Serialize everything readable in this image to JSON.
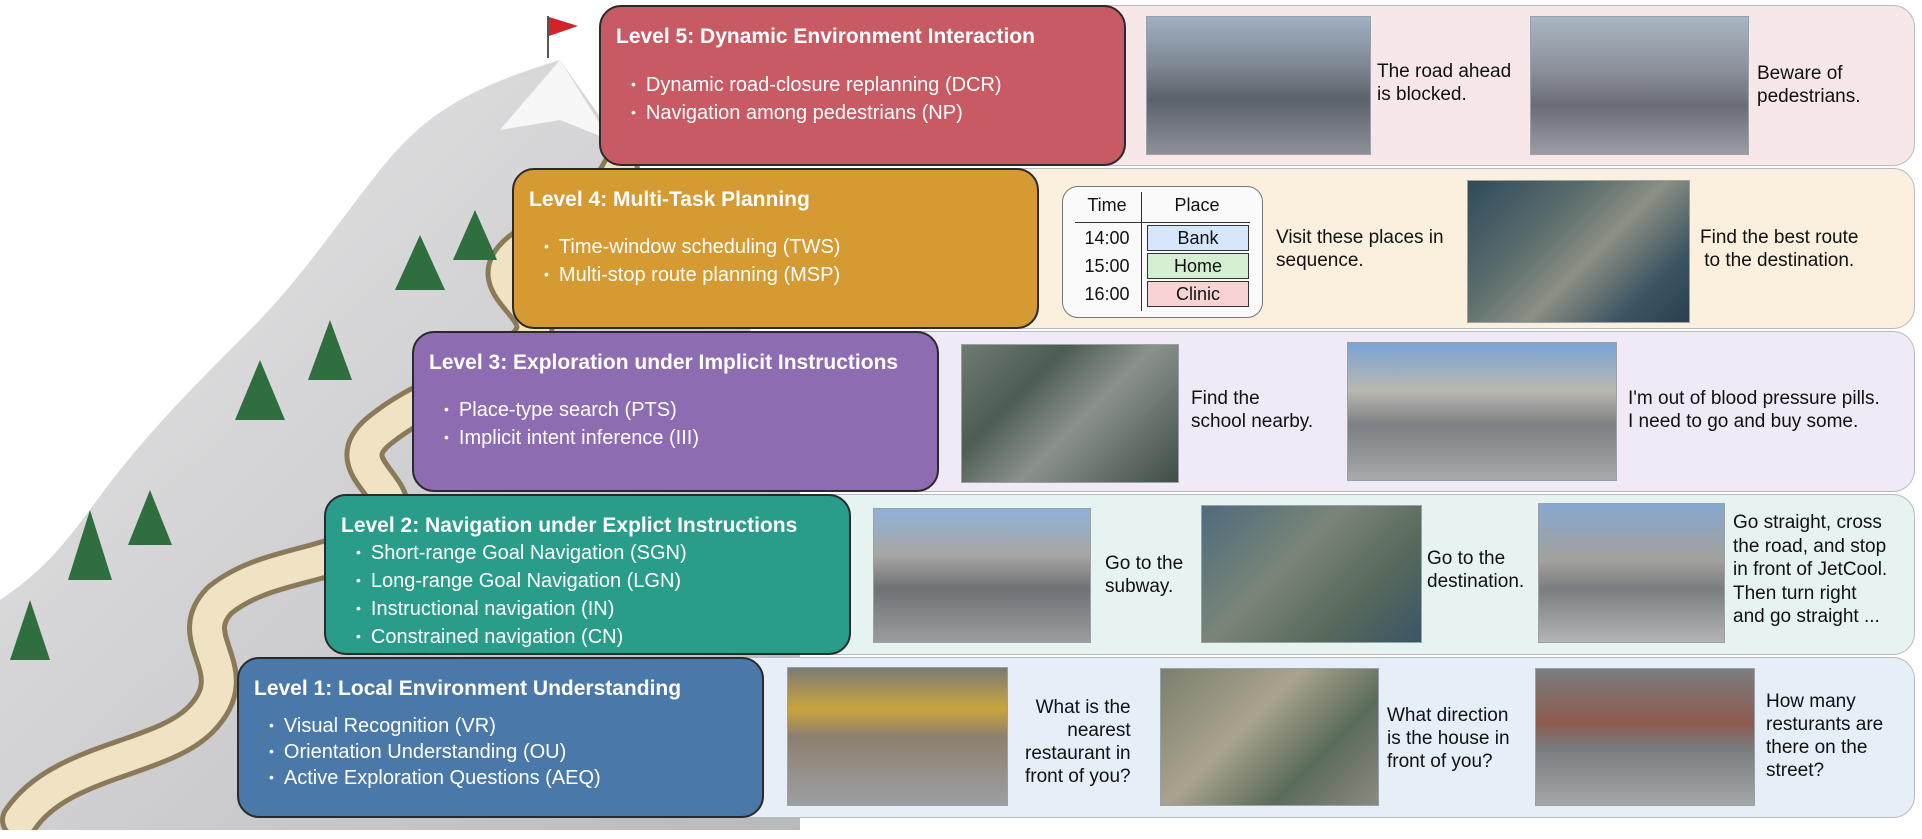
{
  "levels": [
    {
      "title": "Level 5: Dynamic Environment Interaction",
      "items": [
        "Dynamic road-closure replanning (DCR)",
        "Navigation among pedestrians (NP)"
      ],
      "color": "#c85a63",
      "examples": [
        {
          "caption": "The road ahead\nis blocked."
        },
        {
          "caption": "Beware of\npedestrians."
        }
      ]
    },
    {
      "title": "Level 4: Multi-Task Planning",
      "items": [
        "Time-window scheduling (TWS)",
        "Multi-stop route planning (MSP)"
      ],
      "color": "#d59a32",
      "examples": [
        {
          "caption": "Visit these places in\nsequence."
        },
        {
          "caption": "Find the best route\nto the destination."
        }
      ]
    },
    {
      "title": "Level 3: Exploration under Implicit Instructions",
      "items": [
        "Place-type search (PTS)",
        "Implicit intent inference (III)"
      ],
      "color": "#8e6cb2",
      "examples": [
        {
          "caption": "Find the\nschool nearby."
        },
        {
          "caption": "I'm out of blood pressure pills.\nI need to go and buy some."
        }
      ]
    },
    {
      "title": "Level 2: Navigation under Explict Instructions",
      "items": [
        "Short-range Goal Navigation (SGN)",
        "Long-range Goal Navigation (LGN)",
        "Instructional navigation (IN)",
        "Constrained navigation (CN)"
      ],
      "color": "#2a9d8a",
      "examples": [
        {
          "caption": "Go to the\nsubway."
        },
        {
          "caption": "Go to the\ndestination."
        },
        {
          "caption": "Go straight, cross\nthe road, and stop\nin front of JetCool.\nThen turn right\nand go straight ..."
        }
      ]
    },
    {
      "title": "Level 1: Local Environment Understanding",
      "items": [
        "Visual Recognition (VR)",
        "Orientation Understanding (OU)",
        "Active Exploration Questions (AEQ)"
      ],
      "color": "#4a78a8",
      "examples": [
        {
          "caption": "What is the\nnearest\nrestaurant in\nfront of you?"
        },
        {
          "caption": "What direction\nis the house in\nfront of you?"
        },
        {
          "caption": "How many\nresturants are\nthere on the\nstreet?"
        }
      ]
    }
  ],
  "schedule": {
    "headers": [
      "Time",
      "Place"
    ],
    "rows": [
      {
        "time": "14:00",
        "place": "Bank",
        "color": "#d6e6fb"
      },
      {
        "time": "15:00",
        "place": "Home",
        "color": "#d6efd2"
      },
      {
        "time": "16:00",
        "place": "Clinic",
        "color": "#f7d3d3"
      }
    ]
  }
}
